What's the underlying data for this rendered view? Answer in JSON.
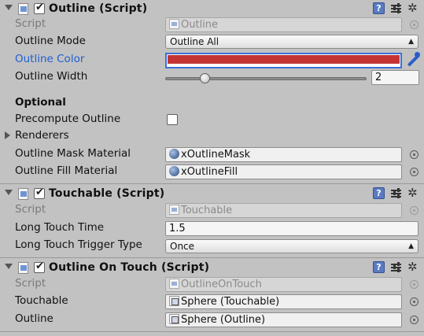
{
  "outline_component": {
    "title": "Outline (Script)",
    "script_label": "Script",
    "script_value": "Outline",
    "mode_label": "Outline Mode",
    "mode_value": "Outline All",
    "color_label": "Outline Color",
    "color_value": "#c53434",
    "width_label": "Outline Width",
    "width_value": "2",
    "width_slider_fraction": 0.2,
    "optional_heading": "Optional",
    "precompute_label": "Precompute Outline",
    "precompute_checked": false,
    "renderers_label": "Renderers",
    "mask_label": "Outline Mask Material",
    "mask_value": "xOutlineMask",
    "fill_label": "Outline Fill Material",
    "fill_value": "xOutlineFill"
  },
  "touchable_component": {
    "title": "Touchable (Script)",
    "script_label": "Script",
    "script_value": "Touchable",
    "long_touch_time_label": "Long Touch Time",
    "long_touch_time_value": "1.5",
    "trigger_type_label": "Long Touch Trigger Type",
    "trigger_type_value": "Once"
  },
  "outline_on_touch_component": {
    "title": "Outline On Touch (Script)",
    "script_label": "Script",
    "script_value": "OutlineOnTouch",
    "touchable_label": "Touchable",
    "touchable_value": "Sphere (Touchable)",
    "outline_label": "Outline",
    "outline_value": "Sphere (Outline)"
  },
  "icons": {
    "help": "help-icon",
    "preset": "preset-icon",
    "gear": "gear-icon",
    "help_glyph": "?",
    "gear_glyph": "✲",
    "checkmark_glyph": "✔"
  },
  "colors": {
    "background": "#c2c2c2",
    "accent_blue": "#3b6fd8",
    "label_blue": "#1f5fd6"
  }
}
